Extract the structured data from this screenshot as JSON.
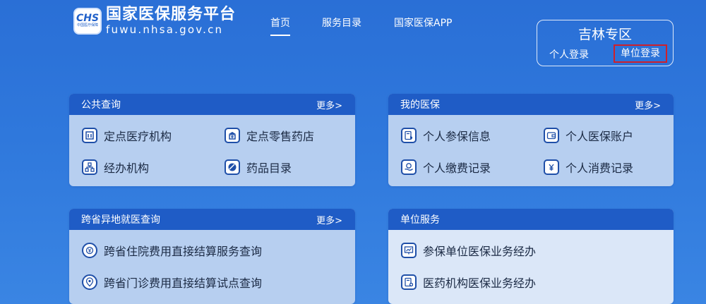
{
  "logo": {
    "mark": "CHS",
    "sub": "中国医疗保障",
    "title_cn": "国家医保服务平台",
    "title_en": "fuwu.nhsa.gov.cn"
  },
  "nav": {
    "items": [
      {
        "label": "首页"
      },
      {
        "label": "服务目录"
      },
      {
        "label": "国家医保APP"
      }
    ]
  },
  "region": {
    "title": "吉林专区",
    "login_personal": "个人登录",
    "login_unit": "单位登录"
  },
  "cards": {
    "public": {
      "title": "公共查询",
      "more": "更多>",
      "items": [
        {
          "label": "定点医疗机构",
          "icon": "hospital-icon"
        },
        {
          "label": "定点零售药店",
          "icon": "pharmacy-icon"
        },
        {
          "label": "经办机构",
          "icon": "org-chart-icon"
        },
        {
          "label": "药品目录",
          "icon": "pill-icon"
        }
      ]
    },
    "mine": {
      "title": "我的医保",
      "more": "更多>",
      "items": [
        {
          "label": "个人参保信息",
          "icon": "document-shield-icon"
        },
        {
          "label": "个人医保账户",
          "icon": "wallet-icon"
        },
        {
          "label": "个人缴费记录",
          "icon": "payment-hand-icon"
        },
        {
          "label": "个人消费记录",
          "icon": "yuan-receipt-icon"
        }
      ]
    },
    "cross": {
      "title": "跨省异地就医查询",
      "more": "更多>",
      "items": [
        {
          "label": "跨省住院费用直接结算服务查询",
          "icon": "clock-yuan-icon"
        },
        {
          "label": "跨省门诊费用直接结算试点查询",
          "icon": "map-pin-icon"
        }
      ]
    },
    "unit": {
      "title": "单位服务",
      "items": [
        {
          "label": "参保单位医保业务经办",
          "icon": "chart-board-icon"
        },
        {
          "label": "医药机构医保业务经办",
          "icon": "document-plus-icon"
        }
      ]
    }
  },
  "colors": {
    "background": "#2f78dc",
    "card_header": "#1f5cc6",
    "card_body": "#b7cff0",
    "card_body_light": "#dbe7f8",
    "highlight_border": "#d0202a"
  }
}
